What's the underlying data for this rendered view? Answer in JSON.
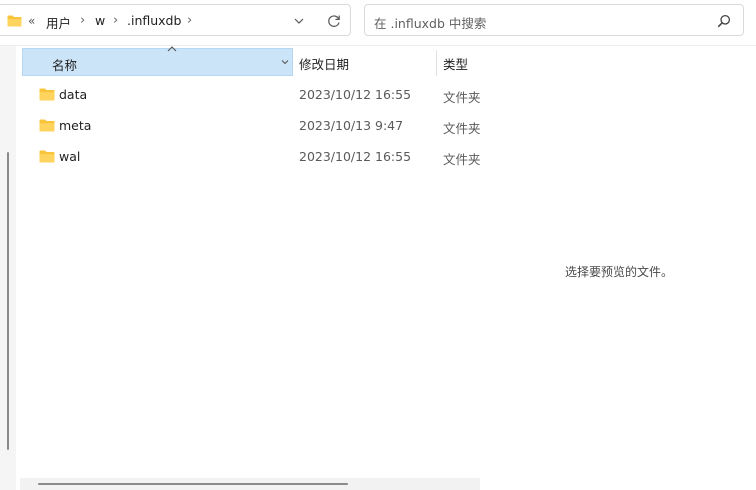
{
  "address": {
    "overflow_glyph": "«",
    "breadcrumbs": [
      "用户",
      "w",
      ".influxdb"
    ],
    "separator": "›",
    "folder_icon": "folder-icon",
    "dropdown_icon": "chevron-down-icon",
    "refresh_icon": "refresh-icon"
  },
  "search": {
    "placeholder": "在 .influxdb 中搜索",
    "icon": "search-icon"
  },
  "columns": {
    "name": "名称",
    "date": "修改日期",
    "type": "类型"
  },
  "files": [
    {
      "name": "data",
      "date": "2023/10/12 16:55",
      "type": "文件夹"
    },
    {
      "name": "meta",
      "date": "2023/10/13 9:47",
      "type": "文件夹"
    },
    {
      "name": "wal",
      "date": "2023/10/12 16:55",
      "type": "文件夹"
    }
  ],
  "preview": {
    "message": "选择要预览的文件。"
  },
  "colors": {
    "folder": "#f8c43b",
    "header_selected": "#cce4f7"
  }
}
